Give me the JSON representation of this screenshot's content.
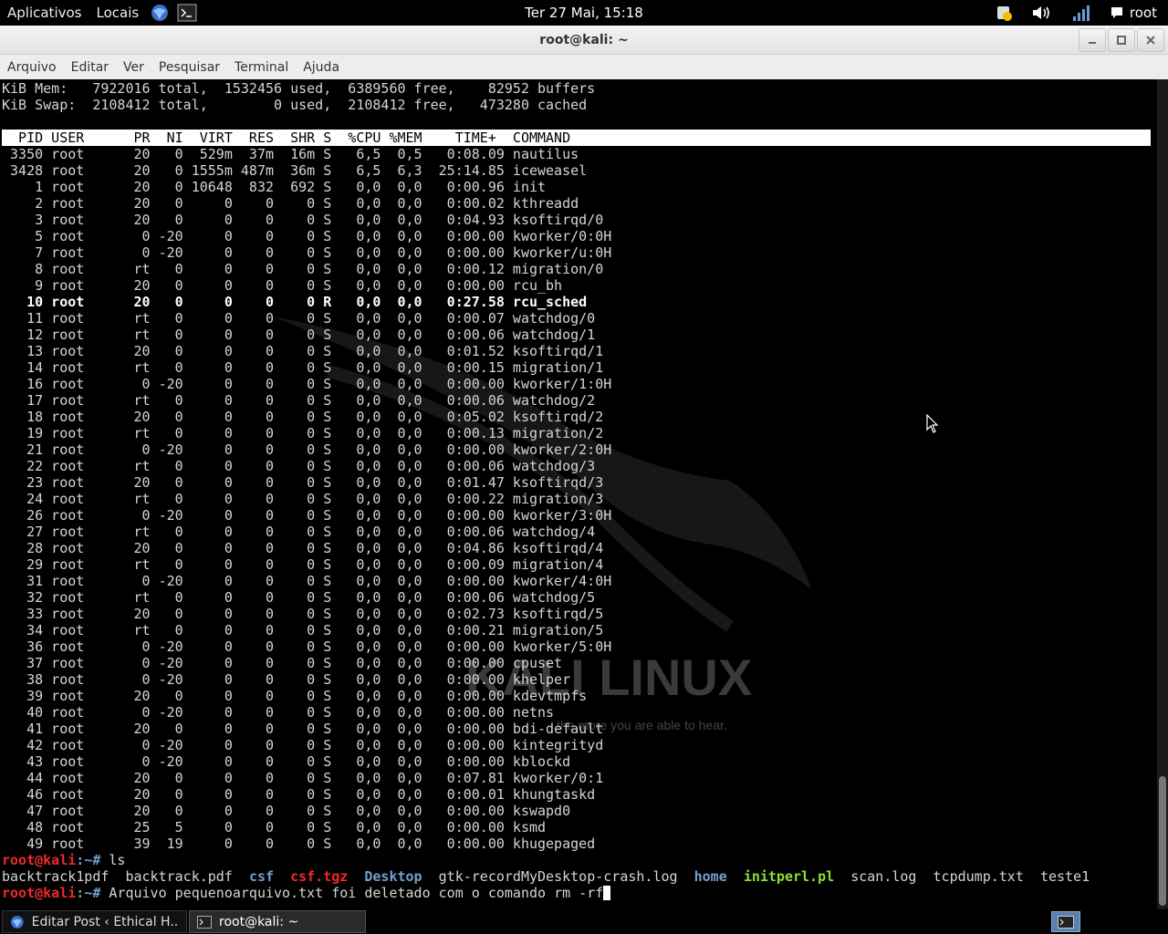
{
  "top_panel": {
    "applications": "Aplicativos",
    "places": "Locais",
    "clock": "Ter 27 Mai, 15:18",
    "user": "root"
  },
  "window": {
    "title": "root@kali: ~",
    "menu": [
      "Arquivo",
      "Editar",
      "Ver",
      "Pesquisar",
      "Terminal",
      "Ajuda"
    ]
  },
  "terminal": {
    "mem_line": "KiB Mem:   7922016 total,  1532456 used,  6389560 free,    82952 buffers",
    "swap_line": "KiB Swap:  2108412 total,        0 used,  2108412 free,   473280 cached",
    "table_header": "  PID USER      PR  NI  VIRT  RES  SHR S  %CPU %MEM    TIME+  COMMAND",
    "processes": [
      " 3350 root      20   0  529m  37m  16m S   6,5  0,5   0:08.09 nautilus",
      " 3428 root      20   0 1555m 487m  36m S   6,5  6,3  25:14.85 iceweasel",
      "    1 root      20   0 10648  832  692 S   0,0  0,0   0:00.96 init",
      "    2 root      20   0     0    0    0 S   0,0  0,0   0:00.02 kthreadd",
      "    3 root      20   0     0    0    0 S   0,0  0,0   0:04.93 ksoftirqd/0",
      "    5 root       0 -20     0    0    0 S   0,0  0,0   0:00.00 kworker/0:0H",
      "    7 root       0 -20     0    0    0 S   0,0  0,0   0:00.00 kworker/u:0H",
      "    8 root      rt   0     0    0    0 S   0,0  0,0   0:00.12 migration/0",
      "    9 root      20   0     0    0    0 S   0,0  0,0   0:00.00 rcu_bh",
      "   10 root      20   0     0    0    0 R   0,0  0,0   0:27.58 rcu_sched",
      "   11 root      rt   0     0    0    0 S   0,0  0,0   0:00.07 watchdog/0",
      "   12 root      rt   0     0    0    0 S   0,0  0,0   0:00.06 watchdog/1",
      "   13 root      20   0     0    0    0 S   0,0  0,0   0:01.52 ksoftirqd/1",
      "   14 root      rt   0     0    0    0 S   0,0  0,0   0:00.15 migration/1",
      "   16 root       0 -20     0    0    0 S   0,0  0,0   0:00.00 kworker/1:0H",
      "   17 root      rt   0     0    0    0 S   0,0  0,0   0:00.06 watchdog/2",
      "   18 root      20   0     0    0    0 S   0,0  0,0   0:05.02 ksoftirqd/2",
      "   19 root      rt   0     0    0    0 S   0,0  0,0   0:00.13 migration/2",
      "   21 root       0 -20     0    0    0 S   0,0  0,0   0:00.00 kworker/2:0H",
      "   22 root      rt   0     0    0    0 S   0,0  0,0   0:00.06 watchdog/3",
      "   23 root      20   0     0    0    0 S   0,0  0,0   0:01.47 ksoftirqd/3",
      "   24 root      rt   0     0    0    0 S   0,0  0,0   0:00.22 migration/3",
      "   26 root       0 -20     0    0    0 S   0,0  0,0   0:00.00 kworker/3:0H",
      "   27 root      rt   0     0    0    0 S   0,0  0,0   0:00.06 watchdog/4",
      "   28 root      20   0     0    0    0 S   0,0  0,0   0:04.86 ksoftirqd/4",
      "   29 root      rt   0     0    0    0 S   0,0  0,0   0:00.09 migration/4",
      "   31 root       0 -20     0    0    0 S   0,0  0,0   0:00.00 kworker/4:0H",
      "   32 root      rt   0     0    0    0 S   0,0  0,0   0:00.06 watchdog/5",
      "   33 root      20   0     0    0    0 S   0,0  0,0   0:02.73 ksoftirqd/5",
      "   34 root      rt   0     0    0    0 S   0,0  0,0   0:00.21 migration/5",
      "   36 root       0 -20     0    0    0 S   0,0  0,0   0:00.00 kworker/5:0H",
      "   37 root       0 -20     0    0    0 S   0,0  0,0   0:00.00 cpuset",
      "   38 root       0 -20     0    0    0 S   0,0  0,0   0:00.00 khelper",
      "   39 root      20   0     0    0    0 S   0,0  0,0   0:00.00 kdevtmpfs",
      "   40 root       0 -20     0    0    0 S   0,0  0,0   0:00.00 netns",
      "   41 root      20   0     0    0    0 S   0,0  0,0   0:00.00 bdi-default",
      "   42 root       0 -20     0    0    0 S   0,0  0,0   0:00.00 kintegrityd",
      "   43 root       0 -20     0    0    0 S   0,0  0,0   0:00.00 kblockd",
      "   44 root      20   0     0    0    0 S   0,0  0,0   0:07.81 kworker/0:1",
      "   46 root      20   0     0    0    0 S   0,0  0,0   0:00.01 khungtaskd",
      "   47 root      20   0     0    0    0 S   0,0  0,0   0:00.00 kswapd0",
      "   48 root      25   5     0    0    0 S   0,0  0,0   0:00.00 ksmd",
      "   49 root      39  19     0    0    0 S   0,0  0,0   0:00.00 khugepaged"
    ],
    "prompt_user": "root@kali",
    "prompt_path": ":~",
    "prompt_symbol": "# ",
    "cmd_ls": "ls",
    "ls_output": {
      "f1": "backtrack1pdf",
      "f2": "backtrack.pdf",
      "d1": "csf",
      "a1": "csf.tgz",
      "d2": "Desktop",
      "f3": "gtk-recordMyDesktop-crash.log",
      "d3": "home",
      "x1": "initperl.pl",
      "f4": "scan.log",
      "f5": "tcpdump.txt",
      "f6": "teste1"
    },
    "current_cmd": "Arquivo pequenoarquivo.txt foi deletado com o comando rm -rf",
    "watermark_title": "KALI LINUX",
    "watermark_tagline": "the more you are able to hear."
  },
  "taskbar": {
    "tasks": [
      {
        "label": "Editar Post ‹ Ethical H..."
      },
      {
        "label": "root@kali: ~"
      }
    ]
  },
  "colors": {
    "prompt_user": "#ef2929",
    "prompt_path": "#729fcf",
    "directory": "#729fcf",
    "archive": "#ef2929",
    "executable": "#8ae234"
  }
}
